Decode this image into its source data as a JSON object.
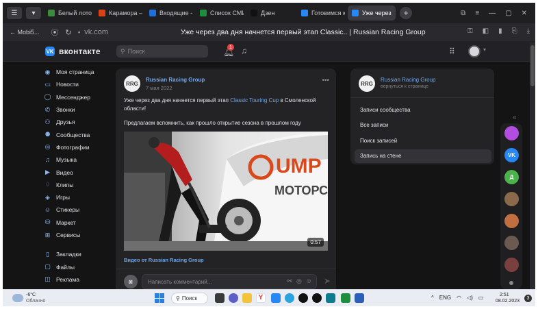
{
  "browser": {
    "tabs": [
      {
        "label": "Белый лотос",
        "color": "#3b8d3b"
      },
      {
        "label": "Караморa —",
        "color": "#d84315"
      },
      {
        "label": "Входящие - ",
        "color": "#1e6fd9"
      },
      {
        "label": "Список СМИ",
        "color": "#1e8e3e"
      },
      {
        "label": "Дзен",
        "color": "#111111"
      },
      {
        "label": "Готовимся к",
        "color": "#2787f5"
      },
      {
        "label": "Уже через",
        "color": "#2787f5",
        "active": true
      }
    ],
    "back_label": "← Mobi5...",
    "host": "vk.com",
    "page_title": "Уже через два дня начнется первый этап Classic.. | Russian Racing Group"
  },
  "vk": {
    "brand": "вконтакте",
    "search_placeholder": "Поиск",
    "notification_count": "1"
  },
  "leftmenu": [
    {
      "label": "Моя страница",
      "icon": "user-circle-icon",
      "glyph": "◉"
    },
    {
      "label": "Новости",
      "icon": "news-icon",
      "glyph": "▭"
    },
    {
      "label": "Мессенджер",
      "icon": "chat-icon",
      "glyph": "◯"
    },
    {
      "label": "Звонки",
      "icon": "phone-icon",
      "glyph": "✆"
    },
    {
      "label": "Друзья",
      "icon": "friends-icon",
      "glyph": "⚇"
    },
    {
      "label": "Сообщества",
      "icon": "communities-icon",
      "glyph": "⚉"
    },
    {
      "label": "Фотографии",
      "icon": "photo-icon",
      "glyph": "◎"
    },
    {
      "label": "Музыка",
      "icon": "music-icon",
      "glyph": "♫"
    },
    {
      "label": "Видео",
      "icon": "video-icon",
      "glyph": "▶"
    },
    {
      "label": "Клипы",
      "icon": "clips-icon",
      "glyph": "♢"
    },
    {
      "label": "Игры",
      "icon": "games-icon",
      "glyph": "◈"
    },
    {
      "label": "Стикеры",
      "icon": "stickers-icon",
      "glyph": "☺"
    },
    {
      "label": "Маркет",
      "icon": "market-icon",
      "glyph": "⛁"
    },
    {
      "label": "Сервисы",
      "icon": "services-icon",
      "glyph": "⊞"
    }
  ],
  "leftmenu_bottom": [
    {
      "label": "Закладки",
      "icon": "bookmark-icon",
      "glyph": "▯"
    },
    {
      "label": "Файлы",
      "icon": "file-icon",
      "glyph": "▢"
    },
    {
      "label": "Реклама",
      "icon": "ads-icon",
      "glyph": "◫"
    }
  ],
  "post": {
    "author": "Russian Racing Group",
    "avatar_text": "RRG",
    "date": "7 мая 2022",
    "text_before": "Уже через два дня начнется первый этап ",
    "text_link": "Classic Touring Cup",
    "text_after": " в Смоленской области!",
    "text2": "Предлагаем вспомнить, как прошло открытие сезона в прошлом году",
    "video_duration": "0:57",
    "video_side_text": "МОТОРС",
    "video_caption": "Видео от Russian Racing Group",
    "comment_placeholder": "Написать комментарий..."
  },
  "right_panel": {
    "name": "Russian Racing Group",
    "back_link": "вернуться к странице",
    "items": [
      {
        "label": "Записи сообщества",
        "selected": false
      },
      {
        "label": "Все записи",
        "selected": false
      },
      {
        "label": "Поиск записей",
        "selected": false
      },
      {
        "label": "Запись на стене",
        "selected": true
      }
    ]
  },
  "right_column": [
    {
      "name": "voice-app-avatar",
      "color": "#b14ee0"
    },
    {
      "name": "vk-app-avatar",
      "color": "#2787f5",
      "text": "VK"
    },
    {
      "name": "contact-d-avatar",
      "color": "#4bb34b",
      "text": "Д"
    },
    {
      "name": "contact-avatar-1",
      "color": "#8a6a4a"
    },
    {
      "name": "contact-avatar-2",
      "color": "#c07040"
    },
    {
      "name": "contact-avatar-3",
      "color": "#6a5a50"
    },
    {
      "name": "contact-avatar-4",
      "color": "#7a4040"
    }
  ],
  "taskbar": {
    "temperature": "-6°C",
    "weather_desc": "Облачно",
    "search_label": "Поиск",
    "lang": "ENG",
    "time": "2:51",
    "date": "08.02.2023",
    "notif_count": "3"
  }
}
